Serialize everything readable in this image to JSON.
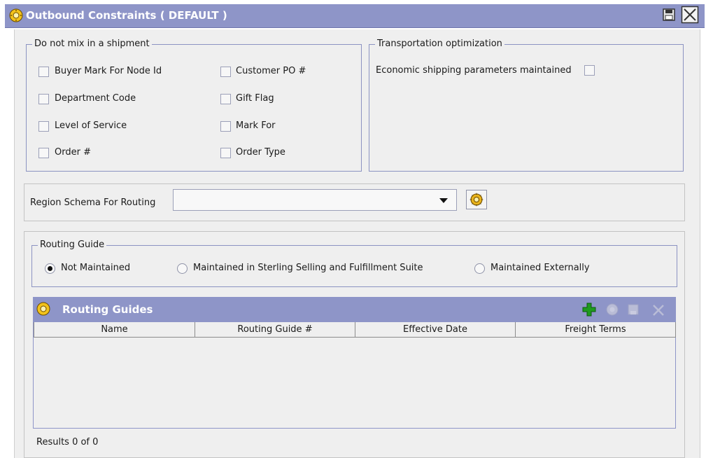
{
  "window": {
    "title": "Outbound Constraints ( DEFAULT )"
  },
  "do_not_mix": {
    "legend": "Do not mix in a shipment",
    "left": [
      {
        "label": "Buyer Mark For Node Id",
        "checked": false
      },
      {
        "label": "Department Code",
        "checked": false
      },
      {
        "label": "Level of Service",
        "checked": false
      },
      {
        "label": "Order #",
        "checked": false
      }
    ],
    "right": [
      {
        "label": "Customer PO #",
        "checked": false
      },
      {
        "label": "Gift Flag",
        "checked": false
      },
      {
        "label": "Mark For",
        "checked": false
      },
      {
        "label": "Order Type",
        "checked": false
      }
    ]
  },
  "transport": {
    "legend": "Transportation optimization",
    "economic_label": "Economic shipping parameters maintained",
    "economic_checked": false
  },
  "region": {
    "label": "Region Schema For Routing",
    "value": ""
  },
  "routing_guide": {
    "legend": "Routing Guide",
    "options": [
      {
        "label": "Not Maintained",
        "selected": true
      },
      {
        "label": "Maintained in Sterling Selling and Fulfillment Suite",
        "selected": false
      },
      {
        "label": "Maintained Externally",
        "selected": false
      }
    ]
  },
  "routing_guides": {
    "title": "Routing Guides",
    "columns": [
      "Name",
      "Routing Guide #",
      "Effective Date",
      "Freight Terms"
    ],
    "rows": [],
    "results_text": "Results 0 of 0"
  },
  "colors": {
    "titlebar": "#8e95c8",
    "panel": "#efefef",
    "add_icon": "#1f9a1f"
  }
}
